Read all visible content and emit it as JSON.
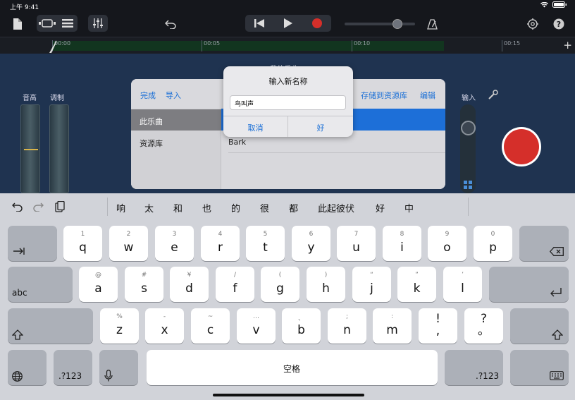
{
  "status": {
    "time": "上午 9:41"
  },
  "project": {
    "title": "我的乐曲 1"
  },
  "ruler": {
    "marks": [
      "00:00",
      "00:05",
      "00:10",
      "00:15"
    ]
  },
  "controls": {
    "pitch_label": "音高",
    "mod_label": "调制",
    "input_label": "输入"
  },
  "loop_browser": {
    "done": "完成",
    "import": "导入",
    "save_to_library": "存储到资源库",
    "edit": "编辑",
    "sources": [
      "此乐曲",
      "资源库"
    ],
    "items": [
      "Bark"
    ]
  },
  "rename_alert": {
    "title": "输入新名称",
    "value": "鸟叫声",
    "cancel": "取消",
    "ok": "好"
  },
  "keyboard": {
    "candidates": [
      "响",
      "太",
      "和",
      "也",
      "的",
      "很",
      "都",
      "此起彼伏",
      "好",
      "中"
    ],
    "row1": [
      {
        "p": "q",
        "s": "1"
      },
      {
        "p": "w",
        "s": "2"
      },
      {
        "p": "e",
        "s": "3"
      },
      {
        "p": "r",
        "s": "4"
      },
      {
        "p": "t",
        "s": "5"
      },
      {
        "p": "y",
        "s": "6"
      },
      {
        "p": "u",
        "s": "7"
      },
      {
        "p": "i",
        "s": "8"
      },
      {
        "p": "o",
        "s": "9"
      },
      {
        "p": "p",
        "s": "0"
      }
    ],
    "row2": [
      {
        "p": "a",
        "s": "@"
      },
      {
        "p": "s",
        "s": "#"
      },
      {
        "p": "d",
        "s": "¥"
      },
      {
        "p": "f",
        "s": "/"
      },
      {
        "p": "g",
        "s": "("
      },
      {
        "p": "h",
        "s": ")"
      },
      {
        "p": "j",
        "s": "“"
      },
      {
        "p": "k",
        "s": "”"
      },
      {
        "p": "l",
        "s": "’"
      }
    ],
    "row3": [
      {
        "p": "z",
        "s": "%"
      },
      {
        "p": "x",
        "s": "-"
      },
      {
        "p": "c",
        "s": "~"
      },
      {
        "p": "v",
        "s": "…"
      },
      {
        "p": "b",
        "s": "、"
      },
      {
        "p": "n",
        "s": ";"
      },
      {
        "p": "m",
        "s": ":"
      },
      {
        "p": "!\n,",
        "s": ""
      },
      {
        "p": "?\n。",
        "s": ""
      }
    ],
    "abc": "abc",
    "numbers": ".?123",
    "space": "空格"
  },
  "colors": {
    "record": "#d52f2a",
    "accent": "#1a6fd6",
    "selection": "#1d6fd8"
  }
}
